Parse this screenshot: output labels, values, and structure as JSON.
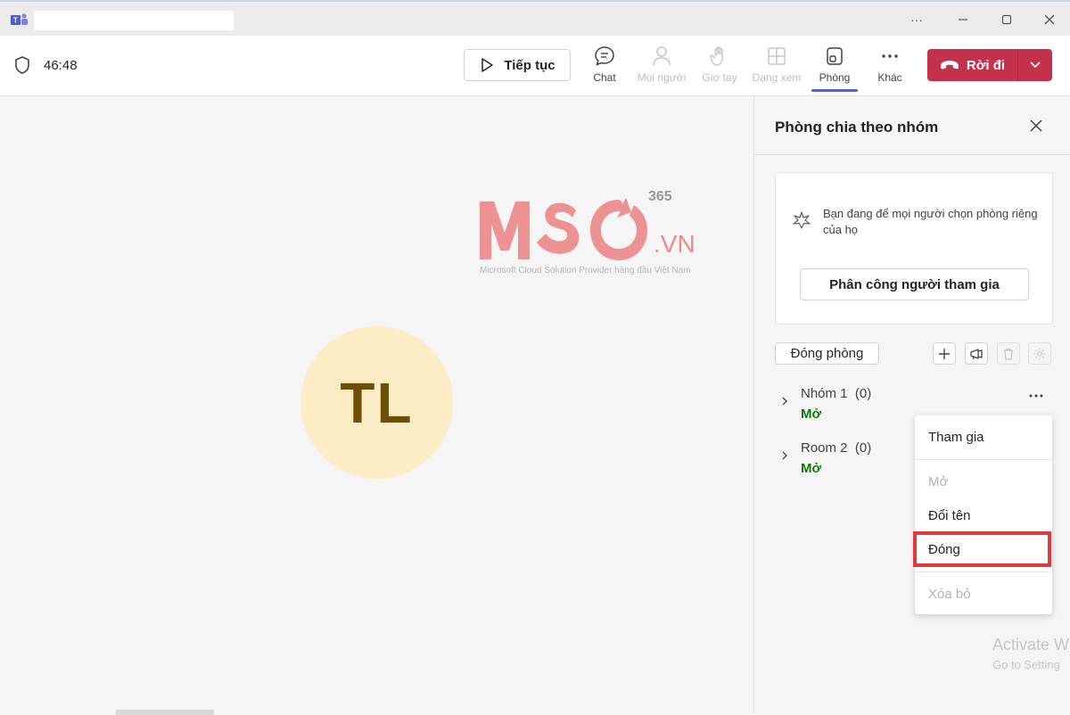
{
  "window": {
    "title": "",
    "more_label": "···"
  },
  "toolbar": {
    "timer": "46:48",
    "resume_label": "Tiếp tục",
    "items": [
      {
        "label": "Chat",
        "icon": "chat-icon",
        "enabled": true
      },
      {
        "label": "Mọi người",
        "icon": "people-icon",
        "enabled": false
      },
      {
        "label": "Giơ tay",
        "icon": "raise-hand-icon",
        "enabled": false
      },
      {
        "label": "Dạng xem",
        "icon": "view-icon",
        "enabled": false
      },
      {
        "label": "Phòng",
        "icon": "rooms-icon",
        "enabled": true,
        "active": true
      },
      {
        "label": "Khác",
        "icon": "more-icon",
        "enabled": true
      }
    ],
    "leave_label": "Rời đi",
    "leave_color": "#c4314b"
  },
  "stage": {
    "avatar_initials": "TL",
    "watermark": {
      "brand": "MSO",
      "suffix": ".VN",
      "superscript": "365",
      "tagline": "Microsoft Cloud Solution Provider hàng đầu Việt Nam"
    }
  },
  "panel": {
    "title": "Phòng chia theo nhóm",
    "info_text": "Bạn đang để mọi người chọn phòng riêng của họ",
    "assign_label": "Phân công người tham gia",
    "close_rooms_label": "Đóng phòng",
    "rooms": [
      {
        "name": "Nhóm 1",
        "count": "(0)",
        "status": "Mở"
      },
      {
        "name": "Room 2",
        "count": "(0)",
        "status": "Mở"
      }
    ]
  },
  "context_menu": {
    "items": [
      {
        "label": "Tham gia",
        "enabled": true
      },
      {
        "label": "Mở",
        "enabled": false
      },
      {
        "label": "Đổi tên",
        "enabled": true
      },
      {
        "label": "Đóng",
        "enabled": true,
        "highlighted": true
      },
      {
        "label": "Xóa bỏ",
        "enabled": false
      }
    ],
    "highlight_color": "#e0393e"
  },
  "os_overlay": {
    "activate_title": "Activate W",
    "activate_sub": "Go to Setting"
  }
}
